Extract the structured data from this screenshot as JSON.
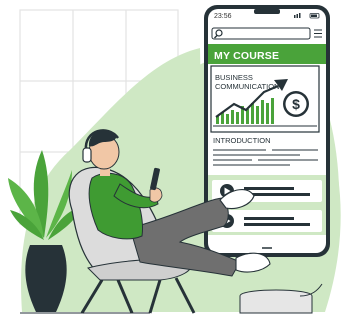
{
  "status_bar": {
    "time": "23:56"
  },
  "app": {
    "heading": "MY COURSE",
    "course_title_line1": "BUSINESS",
    "course_title_line2": "COMMUNICATION",
    "section_label": "INTRODUCTION",
    "currency_symbol": "$"
  },
  "colors": {
    "accent_green": "#4aa33a",
    "light_green": "#cfe8c4",
    "dark": "#263238",
    "shirt_green": "#3f9b32",
    "pants_gray": "#6f6f6f"
  },
  "icons": [
    "search-icon",
    "menu-icon",
    "play-icon",
    "headphones-icon",
    "dollar-icon",
    "trend-arrow-icon"
  ]
}
